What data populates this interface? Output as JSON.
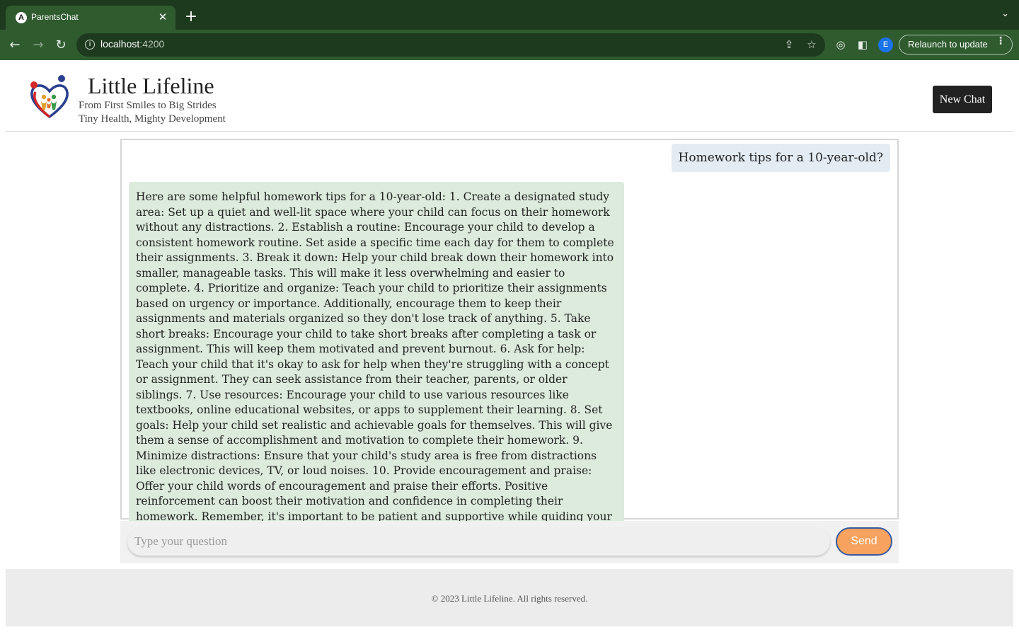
{
  "browser": {
    "tab_title": "ParentsChat",
    "tab_favicon": "A",
    "url_host": "localhost",
    "url_port": ":4200",
    "profile_initial": "E",
    "relaunch_label": "Relaunch to update",
    "icons": [
      "back-icon",
      "forward-icon",
      "reload-icon",
      "info-icon",
      "share-icon",
      "star-icon",
      "extension-icon",
      "sidepanel-icon",
      "menu-dots-icon"
    ]
  },
  "header": {
    "title": "Little Lifeline",
    "tagline1": "From First Smiles to Big Strides",
    "tagline2": "Tiny Health, Mighty Development",
    "new_chat_label": "New Chat"
  },
  "chat": {
    "messages": [
      {
        "role": "user",
        "text": "Homework tips for a 10-year-old?"
      },
      {
        "role": "assistant",
        "text": "Here are some helpful homework tips for a 10-year-old: 1. Create a designated study area: Set up a quiet and well-lit space where your child can focus on their homework without any distractions. 2. Establish a routine: Encourage your child to develop a consistent homework routine. Set aside a specific time each day for them to complete their assignments. 3. Break it down: Help your child break down their homework into smaller, manageable tasks. This will make it less overwhelming and easier to complete. 4. Prioritize and organize: Teach your child to prioritize their assignments based on urgency or importance. Additionally, encourage them to keep their assignments and materials organized so they don't lose track of anything. 5. Take short breaks: Encourage your child to take short breaks after completing a task or assignment. This will keep them motivated and prevent burnout. 6. Ask for help: Teach your child that it's okay to ask for help when they're struggling with a concept or assignment. They can seek assistance from their teacher, parents, or older siblings. 7. Use resources: Encourage your child to use various resources like textbooks, online educational websites, or apps to supplement their learning. 8. Set goals: Help your child set realistic and achievable goals for themselves. This will give them a sense of accomplishment and motivation to complete their homework. 9. Minimize distractions: Ensure that your child's study area is free from distractions like electronic devices, TV, or loud noises. 10. Provide encouragement and praise: Offer your child words of encouragement and praise their efforts. Positive reinforcement can boost their motivation and confidence in completing their homework. Remember, it's important to be patient and supportive while guiding your child through their homework."
      }
    ]
  },
  "input": {
    "placeholder": "Type your question",
    "value": "",
    "send_label": "Send"
  },
  "footer": {
    "text": "© 2023 Little Lifeline. All rights reserved."
  },
  "colors": {
    "browser_frame": "#1e3a1e",
    "browser_toolbar": "#2f5b2f",
    "user_bubble": "#e3ecf3",
    "assistant_bubble": "#dcebdc",
    "send_button": "#f7a25e",
    "new_chat_button": "#222222"
  }
}
